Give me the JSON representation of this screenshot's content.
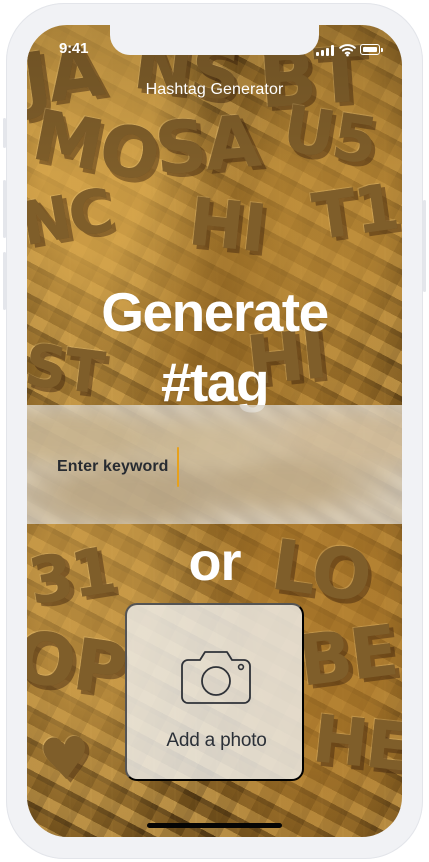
{
  "status_bar": {
    "time": "9:41",
    "icons": [
      "signal-icon",
      "wifi-icon",
      "battery-icon"
    ]
  },
  "app": {
    "title": "Hashtag Generator"
  },
  "hero": {
    "line_1": "Generate",
    "line_2": "#tag"
  },
  "search": {
    "placeholder": "Enter keyword",
    "value": ""
  },
  "divider": {
    "label": "or"
  },
  "photo_upload": {
    "icon": "camera-icon",
    "label": "Add a photo"
  },
  "colors": {
    "text_primary": "#ffffff",
    "input_text": "#272b31",
    "cursor": "#e7a11b",
    "card_background": "#eeeeeb",
    "photo_background": "#7d5c23"
  }
}
